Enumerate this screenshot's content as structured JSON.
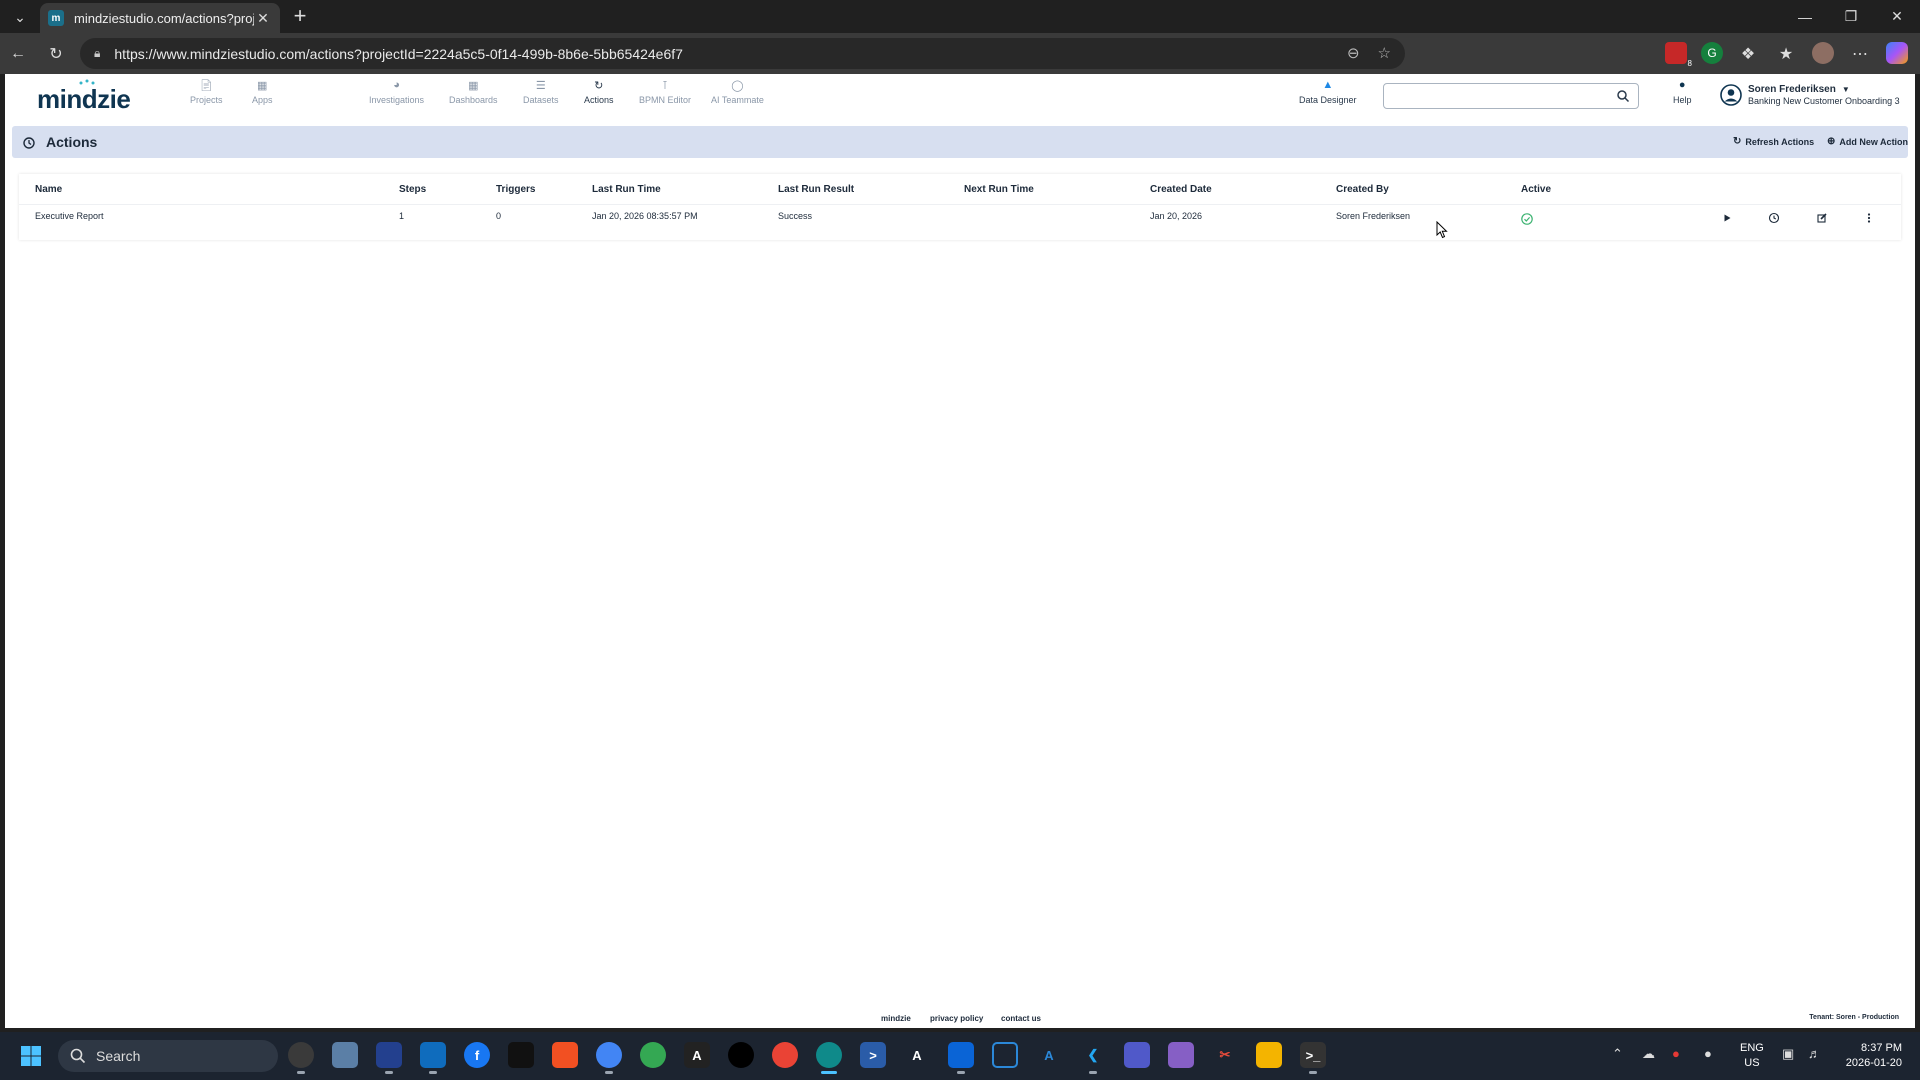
{
  "browser": {
    "tab_title": "mindziestudio.com/actions?proje",
    "favicon_letter": "m",
    "url": "https://www.mindziestudio.com/actions?projectId=2224a5c5-0f14-499b-8b6e-5bb65424e6f7",
    "extension_badge": "8"
  },
  "app": {
    "logo": "mindzie",
    "nav": [
      {
        "label": "Projects",
        "icon": "document-icon"
      },
      {
        "label": "Apps",
        "icon": "apps-icon"
      },
      {
        "label": "Investigations",
        "icon": "pie-chart-icon"
      },
      {
        "label": "Dashboards",
        "icon": "grid-icon"
      },
      {
        "label": "Datasets",
        "icon": "database-icon"
      },
      {
        "label": "Actions",
        "icon": "refresh-icon"
      },
      {
        "label": "BPMN Editor",
        "icon": "bpmn-icon"
      },
      {
        "label": "AI Teammate",
        "icon": "chat-icon"
      }
    ],
    "data_designer": "Data Designer",
    "help": "Help",
    "user": {
      "name": "Soren Frederiksen",
      "project": "Banking New Customer Onboarding 3"
    }
  },
  "actions": {
    "title": "Actions",
    "refresh_label": "Refresh Actions",
    "add_label": "Add New Action",
    "columns": [
      "Name",
      "Steps",
      "Triggers",
      "Last Run Time",
      "Last Run Result",
      "Next Run Time",
      "Created Date",
      "Created By",
      "Active"
    ],
    "rows": [
      {
        "name": "Executive Report",
        "steps": "1",
        "triggers": "0",
        "last_run_time": "Jan 20, 2026 08:35:57 PM",
        "last_run_result": "Success",
        "next_run_time": "",
        "created_date": "Jan 20, 2026",
        "created_by": "Soren Frederiksen",
        "active": true
      }
    ]
  },
  "footer": {
    "links": [
      "mindzie",
      "privacy policy",
      "contact us"
    ],
    "tenant": "Tenant: Soren - Production"
  },
  "taskbar": {
    "search_placeholder": "Search",
    "lang_1": "ENG",
    "lang_2": "US",
    "time": "8:37 PM",
    "date": "2026-01-20"
  },
  "colors": {
    "header_bar": "#d7dff0",
    "active_green": "#3cb371",
    "logo_navy": "#0f3551"
  }
}
